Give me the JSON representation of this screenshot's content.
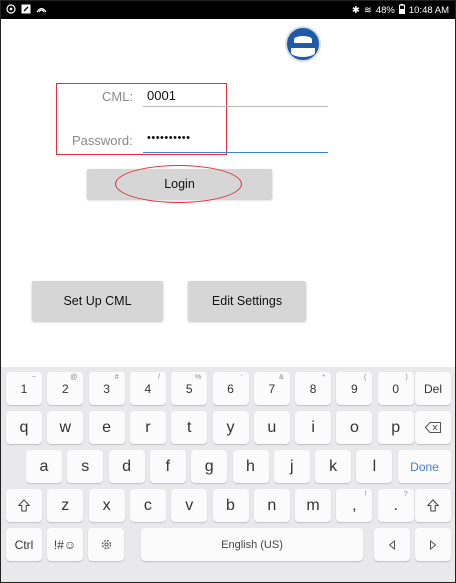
{
  "status_bar": {
    "left_icons": [
      "circle-icon",
      "square-app-icon",
      "signal-icon"
    ],
    "bluetooth": "✱",
    "wifi": "≋",
    "battery_percent": "48%",
    "time": "10:48 AM"
  },
  "form": {
    "cml_label": "CML:",
    "cml_value": "0001",
    "password_label": "Password:",
    "password_value": "••••••••••"
  },
  "buttons": {
    "login": "Login",
    "setup_cml": "Set Up CML",
    "edit_settings": "Edit Settings"
  },
  "keyboard": {
    "row1": [
      {
        "k": "1",
        "s": "~"
      },
      {
        "k": "2",
        "s": "@"
      },
      {
        "k": "3",
        "s": "#"
      },
      {
        "k": "4",
        "s": "/"
      },
      {
        "k": "5",
        "s": "%"
      },
      {
        "k": "6",
        "s": "'"
      },
      {
        "k": "7",
        "s": "&"
      },
      {
        "k": "8",
        "s": "*"
      },
      {
        "k": "9",
        "s": "("
      },
      {
        "k": "0",
        "s": ")"
      }
    ],
    "del": "Del",
    "row2": [
      "q",
      "w",
      "e",
      "r",
      "t",
      "y",
      "u",
      "i",
      "o",
      "p"
    ],
    "row3": [
      "a",
      "s",
      "d",
      "f",
      "g",
      "h",
      "j",
      "k",
      "l"
    ],
    "done": "Done",
    "row4": [
      "z",
      "x",
      "c",
      "v",
      "b",
      "n",
      "m",
      ",",
      "."
    ],
    "row4_sup": {
      "comma": "!",
      "period": "?"
    },
    "ctrl": "Ctrl",
    "symbols": "!#☺",
    "space": "English (US)"
  },
  "colors": {
    "status_bar": "#000000",
    "accent": "#3f7fd6",
    "annotation_red": "#e0303a",
    "button": "#d6d6d6",
    "keyboard_bg": "#e9e9ec"
  }
}
